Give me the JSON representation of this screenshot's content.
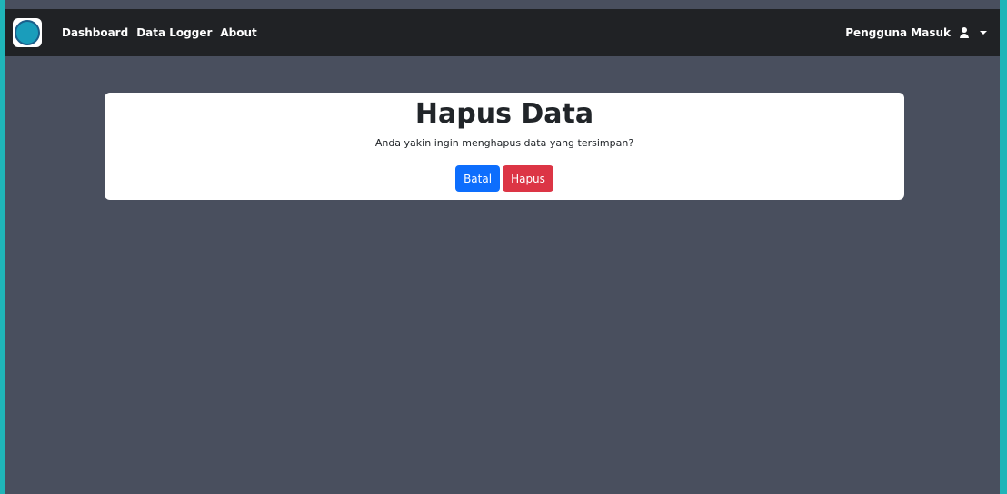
{
  "nav": {
    "links": [
      "Dashboard",
      "Data Logger",
      "About"
    ],
    "user_label": "Pengguna Masuk",
    "user_icon": "user-icon",
    "caret_icon": "caret-down-icon"
  },
  "dialog": {
    "title": "Hapus Data",
    "message": "Anda yakin ingin menghapus data yang tersimpan?",
    "cancel_label": "Batal",
    "delete_label": "Hapus"
  },
  "colors": {
    "navbar": "#202225",
    "page_bg": "#494f5e",
    "primary": "#0d6efd",
    "danger": "#dc3545",
    "accent": "#1fb5b8"
  }
}
